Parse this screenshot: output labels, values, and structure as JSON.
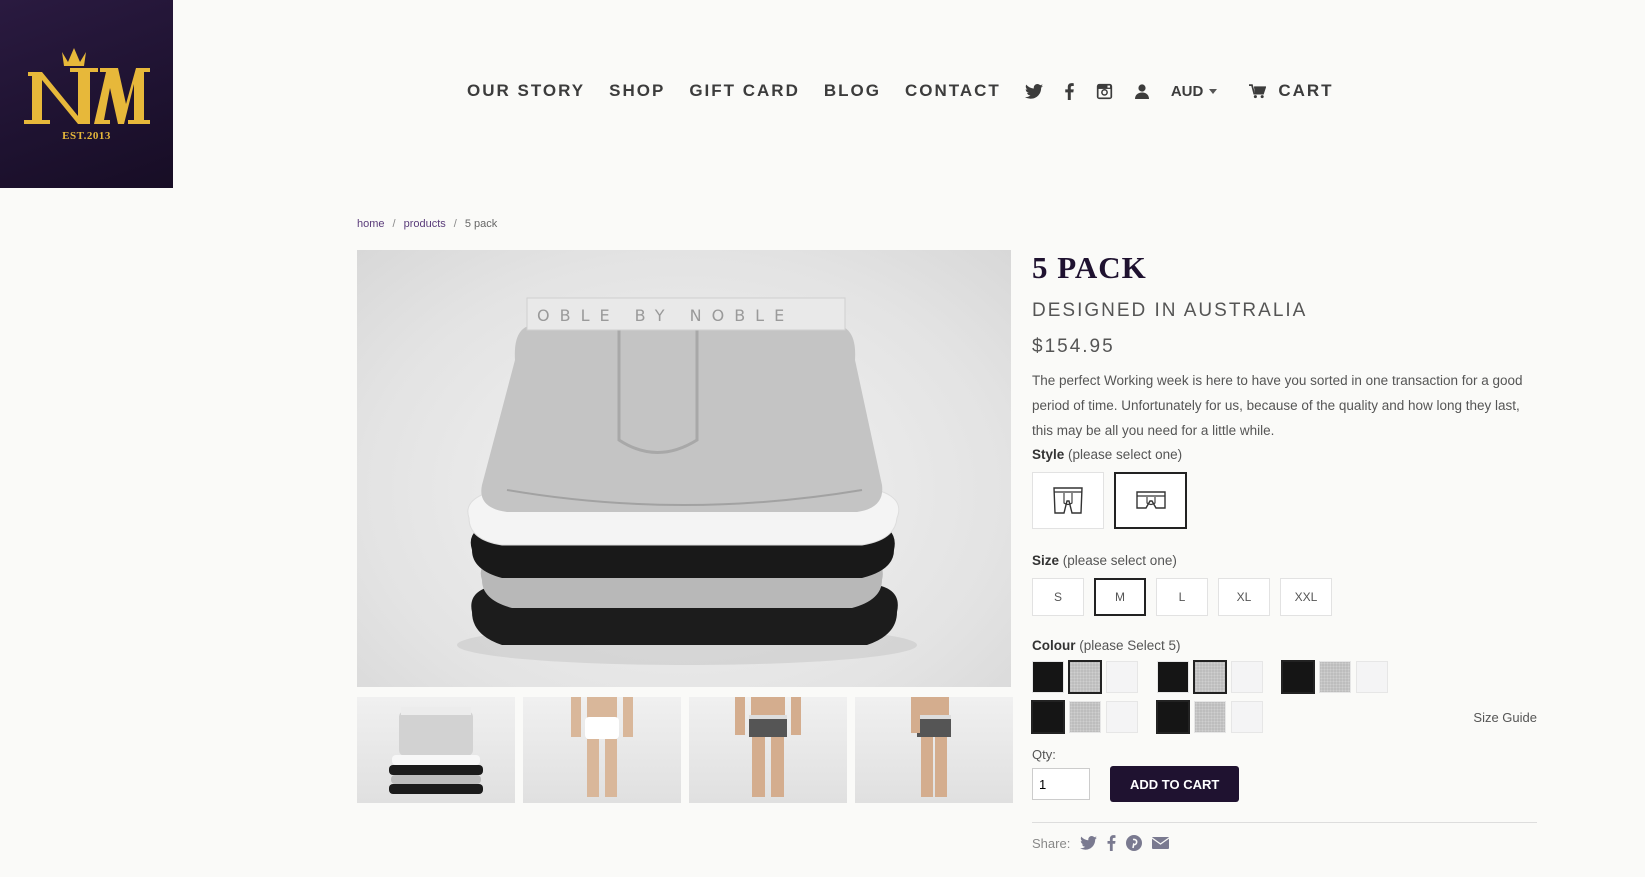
{
  "brand": {
    "logo_text": "NM",
    "est": "EST.2013",
    "gold": "#e7b83a",
    "bg": "#1f1230"
  },
  "nav": {
    "links": [
      "OUR STORY",
      "SHOP",
      "GIFT CARD",
      "BLOG",
      "CONTACT"
    ],
    "icons": [
      "twitter-icon",
      "facebook-icon",
      "instagram-icon",
      "user-icon"
    ],
    "currency": "AUD",
    "cart": "CART"
  },
  "breadcrumb": {
    "home": "home",
    "products": "products",
    "current": "5 pack",
    "sep": "/"
  },
  "product": {
    "title": "5 PACK",
    "subtitle": "DESIGNED IN AUSTRALIA",
    "price": "$154.95",
    "description": "The perfect Working week is here to have you sorted in one transaction for a good period of time. Unfortunately for us, because of the quality and how long they last, this may be all you need for a little while.",
    "style_label": "Style",
    "style_hint": " (please select one)",
    "styles": [
      "long-leg-trunk",
      "short-trunk"
    ],
    "style_selected": 1,
    "size_label": "Size",
    "size_hint": " (please select one)",
    "sizes": [
      "S",
      "M",
      "L",
      "XL",
      "XXL"
    ],
    "size_selected": "M",
    "colour_label": "Colour",
    "colour_hint": " (please Select 5)",
    "colour_rows": [
      [
        [
          "black",
          false
        ],
        [
          "grey",
          true
        ],
        [
          "white",
          false
        ],
        null,
        [
          "black",
          false
        ],
        [
          "grey",
          true
        ],
        [
          "white",
          false
        ],
        null,
        [
          "black",
          true
        ],
        [
          "grey",
          false
        ],
        [
          "white",
          false
        ]
      ],
      [
        [
          "black",
          true
        ],
        [
          "grey",
          false
        ],
        [
          "white",
          false
        ],
        null,
        [
          "black",
          true
        ],
        [
          "grey",
          false
        ],
        [
          "white",
          false
        ]
      ]
    ],
    "size_guide": "Size Guide",
    "qty_label": "Qty:",
    "qty_value": "1",
    "add_to_cart": "ADD TO CART",
    "share_label": "Share:",
    "share_icons": [
      "twitter-icon",
      "facebook-icon",
      "pinterest-icon",
      "email-icon"
    ],
    "waistband_text": "OBLE BY NOBLE"
  },
  "thumbnails": [
    "stack",
    "white-back",
    "grey-front",
    "grey-side"
  ]
}
